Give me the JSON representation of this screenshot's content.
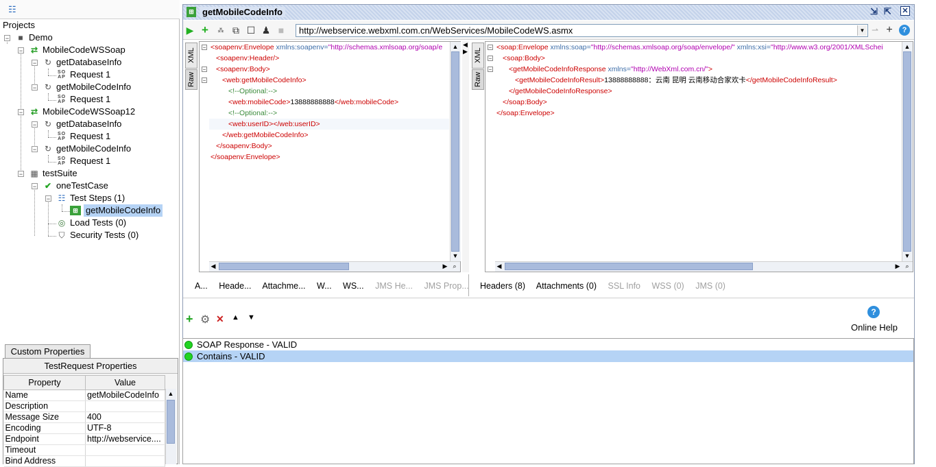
{
  "navigator": {
    "root_label": "Projects",
    "tree": [
      {
        "label": "Demo",
        "icon": "folder-icon"
      },
      {
        "label": "MobileCodeWSSoap",
        "icon": "interface-icon"
      },
      {
        "label": "getDatabaseInfo",
        "icon": "operation-icon"
      },
      {
        "label": "Request 1",
        "icon": "soap-request-icon"
      },
      {
        "label": "getMobileCodeInfo",
        "icon": "operation-icon"
      },
      {
        "label": "Request 1",
        "icon": "soap-request-icon"
      },
      {
        "label": "MobileCodeWSSoap12",
        "icon": "interface-icon"
      },
      {
        "label": "getDatabaseInfo",
        "icon": "operation-icon"
      },
      {
        "label": "Request 1",
        "icon": "soap-request-icon"
      },
      {
        "label": "getMobileCodeInfo",
        "icon": "operation-icon"
      },
      {
        "label": "Request 1",
        "icon": "soap-request-icon"
      },
      {
        "label": "testSuite",
        "icon": "testsuite-icon"
      },
      {
        "label": "oneTestCase",
        "icon": "testcase-icon"
      },
      {
        "label": "Test Steps (1)",
        "icon": "teststeps-icon"
      },
      {
        "label": "getMobileCodeInfo",
        "icon": "teststep-icon",
        "selected": true
      },
      {
        "label": "Load Tests (0)",
        "icon": "loadtest-icon"
      },
      {
        "label": "Security Tests (0)",
        "icon": "security-icon"
      }
    ]
  },
  "properties": {
    "tab_label": "Custom Properties",
    "title": "TestRequest Properties",
    "col_property": "Property",
    "col_value": "Value",
    "rows": [
      {
        "name": "Name",
        "value": "getMobileCodeInfo"
      },
      {
        "name": "Description",
        "value": ""
      },
      {
        "name": "Message Size",
        "value": "400"
      },
      {
        "name": "Encoding",
        "value": "UTF-8"
      },
      {
        "name": "Endpoint",
        "value": "http://webservice...."
      },
      {
        "name": "Timeout",
        "value": ""
      },
      {
        "name": "Bind Address",
        "value": ""
      }
    ]
  },
  "editor": {
    "title": "getMobileCodeInfo",
    "endpoint": "http://webservice.webxml.com.cn/WebServices/MobileCodeWS.asmx",
    "request_tabs": {
      "xml": "XML",
      "raw": "Raw"
    },
    "response_tabs": {
      "xml": "XML",
      "raw": "Raw"
    },
    "request_bottom_tabs": [
      {
        "label": "A...",
        "disabled": false
      },
      {
        "label": "Heade...",
        "disabled": false
      },
      {
        "label": "Attachme...",
        "disabled": false
      },
      {
        "label": "W...",
        "disabled": false
      },
      {
        "label": "WS...",
        "disabled": false
      },
      {
        "label": "JMS He...",
        "disabled": true
      },
      {
        "label": "JMS Prop...",
        "disabled": true
      }
    ],
    "response_bottom_tabs": [
      {
        "label": "Headers (8)",
        "disabled": false
      },
      {
        "label": "Attachments (0)",
        "disabled": false
      },
      {
        "label": "SSL Info",
        "disabled": true
      },
      {
        "label": "WSS (0)",
        "disabled": true
      },
      {
        "label": "JMS (0)",
        "disabled": true
      }
    ],
    "request_xml": {
      "l1_tag": "<soapenv:Envelope",
      "l1_attr": " xmlns:soapenv=",
      "l1_str": "\"http://schemas.xmlsoap.org/soap/e",
      "l2": "<soapenv:Header/>",
      "l3": "<soapenv:Body>",
      "l4": "<web:getMobileCodeInfo>",
      "l5": "<!--Optional:-->",
      "l6_open": "<web:mobileCode>",
      "l6_text": "13888888888",
      "l6_close": "</web:mobileCode>",
      "l7": "<!--Optional:-->",
      "l8_open": "<web:userID>",
      "l8_close": "</web:userID>",
      "l9": "</web:getMobileCodeInfo>",
      "l10": "</soapenv:Body>",
      "l11": "</soapenv:Envelope>"
    },
    "response_xml": {
      "l1_tag": "<soap:Envelope",
      "l1_attr1": " xmlns:soap=",
      "l1_str1": "\"http://schemas.xmlsoap.org/soap/envelope/\"",
      "l1_attr2": " xmlns:xsi=",
      "l1_str2": "\"http://www.w3.org/2001/XMLSchei",
      "l2": "<soap:Body>",
      "l3_tag": "<getMobileCodeInfoResponse",
      "l3_attr": " xmlns=",
      "l3_str": "\"http://WebXml.com.cn/\"",
      "l3_end": ">",
      "l4_open": "<getMobileCodeInfoResult>",
      "l4_text": "13888888888：云南 昆明 云南移动合家欢卡",
      "l4_close": "</getMobileCodeInfoResult>",
      "l5": "</getMobileCodeInfoResponse>",
      "l6": "</soap:Body>",
      "l7": "</soap:Envelope>"
    }
  },
  "assertions": {
    "online_help": "Online Help",
    "items": [
      {
        "label": "SOAP Response - VALID",
        "selected": false
      },
      {
        "label": "Contains - VALID",
        "selected": true
      }
    ]
  },
  "colors": {
    "valid": "#22d422",
    "selection": "#b5d3f5",
    "accent": "#2f8fdd"
  }
}
